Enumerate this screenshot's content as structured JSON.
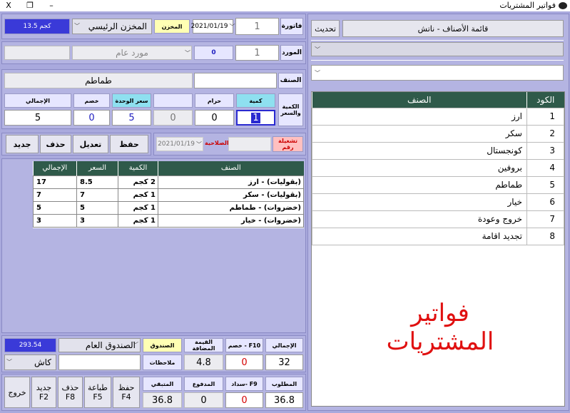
{
  "window": {
    "title": "فواتير المشتريات",
    "minimize": "–",
    "maximize": "❐",
    "close": "X"
  },
  "header": {
    "invoice_label": "فاتورة",
    "invoice_no": "1",
    "date": "2021/01/19",
    "warehouse_label": "المخزن",
    "warehouse": "المخزن الرئيسي",
    "weight": "13.5 كجم",
    "supplier_label": "المورد",
    "supplier_no": "1",
    "supplier_balance": "0",
    "supplier": "مورد عام"
  },
  "item": {
    "item_label": "الصنف",
    "item_code": "",
    "item_name": "طماطم",
    "qty_price_label": "الكمية والسعر",
    "headers": {
      "qty": "كمية",
      "free": "حرام",
      "blank": "",
      "unit_price": "سعر الوحدة",
      "discount": "خصم",
      "total": "الإجمالي"
    },
    "values": {
      "qty": "1",
      "free": "0",
      "blank": "0",
      "unit_price": "5",
      "discount": "0",
      "total": "5"
    }
  },
  "batch": {
    "batch_label": "تشغيلة رقم",
    "batch_no": "",
    "expiry_label": "الصلاحية",
    "expiry_date": "2021/01/19"
  },
  "actions": {
    "save": "حفظ",
    "edit": "تعديل",
    "delete": "حذف",
    "new": "جديد"
  },
  "invoice_table": {
    "headers": [
      "الصنف",
      "الكمية",
      "السعر",
      "الإجمالي"
    ],
    "rows": [
      {
        "item": "(بقوليات) - ارز",
        "qty": "2 كجم",
        "price": "8.5",
        "total": "17"
      },
      {
        "item": "(بقوليات) - سكر",
        "qty": "1 كجم",
        "price": "7",
        "total": "7"
      },
      {
        "item": "(خضروات) - طماطم",
        "qty": "1 كجم",
        "price": "5",
        "total": "5"
      },
      {
        "item": "(خضروات) - خيار",
        "qty": "1 كجم",
        "price": "3",
        "total": "3"
      }
    ]
  },
  "right_panel": {
    "list_title": "قائمة الأصناف - ناتش",
    "refresh": "تحديث",
    "headers": {
      "code": "الكود",
      "item": "الصنف"
    },
    "items": [
      {
        "code": "1",
        "name": "ارز"
      },
      {
        "code": "2",
        "name": "سكر"
      },
      {
        "code": "3",
        "name": "كونجستال"
      },
      {
        "code": "4",
        "name": "بروفين"
      },
      {
        "code": "5",
        "name": "طماطم"
      },
      {
        "code": "6",
        "name": "خيار"
      },
      {
        "code": "7",
        "name": "خروج وعودة"
      },
      {
        "code": "8",
        "name": "تجديد اقامة"
      }
    ],
    "watermark": "فواتير المشتريات"
  },
  "footer": {
    "total_label": "الإجمالي",
    "total": "32",
    "discount_label": "خصم - F10",
    "discount": "0",
    "vat_label": "القيمة المضافة",
    "vat": "4.8",
    "cashbox_label": "الصندوق",
    "cashbox": "الصندوق العام",
    "cashbox_balance": "293.54",
    "notes_label": "ملاحظات",
    "notes": "",
    "payment_method": "كاش",
    "required_label": "المطلوب",
    "required": "36.8",
    "pay_label": "سداد- F9",
    "pay": "0",
    "paid_label": "المدفوع",
    "paid": "0",
    "remaining_label": "المتبقي",
    "remaining": "36.8"
  },
  "bottom_buttons": {
    "save": "حفظ\nF4",
    "print": "طباعة\nF5",
    "delete": "حذف\nF8",
    "new": "جديد\nF2",
    "exit": "خروج"
  },
  "colors": {
    "window_bg": "#a9a9dd",
    "table_header": "#2f5a4a",
    "accent_blue": "#3a3ad8",
    "watermark": "#e01010",
    "zero_red": "#d40000"
  }
}
